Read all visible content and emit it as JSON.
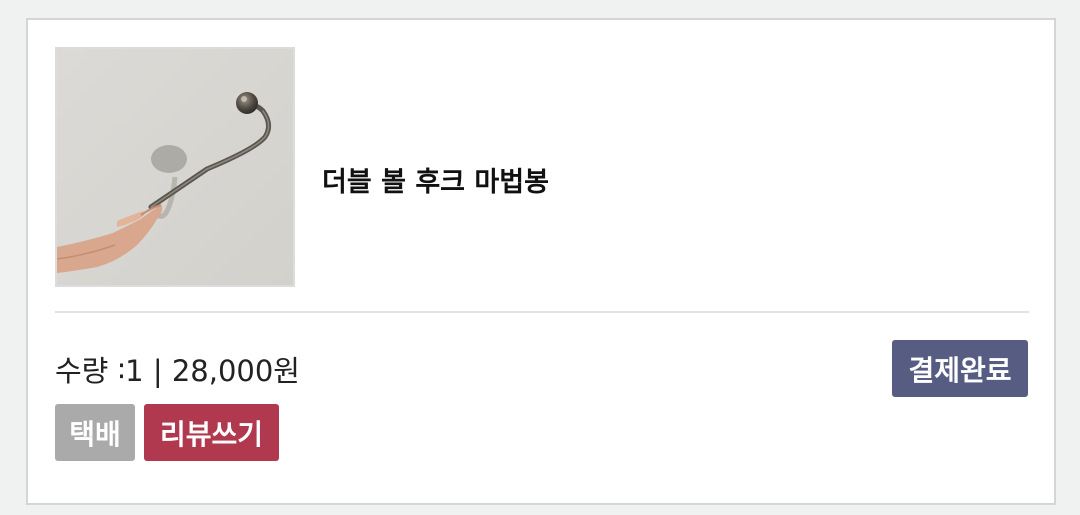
{
  "product": {
    "name": "더블 볼 후크 마법봉",
    "image_alt": "hand-holding-metal-hook-wand"
  },
  "order": {
    "quantity_label": "수량",
    "quantity_separator": "∶",
    "quantity": "1",
    "divider": "|",
    "price": "28,000원"
  },
  "status": {
    "label": "결제완료",
    "color": "#575c83"
  },
  "actions": {
    "delivery_label": "택배",
    "delivery_color": "#aaaaaa",
    "review_label": "리뷰쓰기",
    "review_color": "#b0394f"
  }
}
